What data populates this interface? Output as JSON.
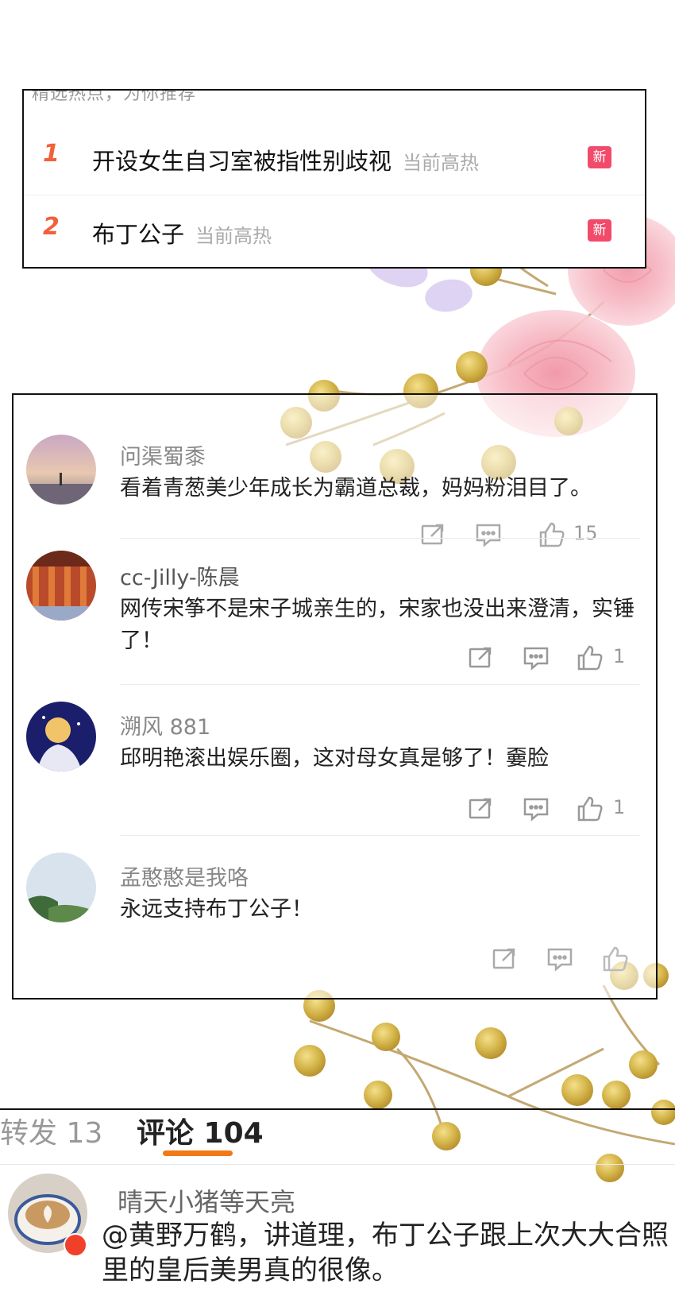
{
  "trending": {
    "subtitle": "精选热点，为你推荐",
    "items": [
      {
        "rank": "1",
        "title": "开设女生自习室被指性别歧视",
        "tag": "当前高热",
        "badge": "新"
      },
      {
        "rank": "2",
        "title": "布丁公子",
        "tag": "当前高热",
        "badge": "新"
      }
    ],
    "rank_color": "#f2603b",
    "badge_color": "#f24a6a"
  },
  "comments": [
    {
      "user": "问渠蜀黍",
      "text": "看着青葱美少年成长为霸道总裁，妈妈粉泪目了。",
      "likes": "15"
    },
    {
      "user": "cc-Jilly-陈晨",
      "text": "网传宋筝不是宋子城亲生的，宋家也没出来澄清，实锤了！",
      "likes": "1"
    },
    {
      "user": "溯风 881",
      "text": "邱明艳滚出娱乐圈，这对母女真是够了！嫑脸",
      "likes": "1"
    },
    {
      "user": "孟憨憨是我咯",
      "text": "永远支持布丁公子！",
      "likes": ""
    }
  ],
  "tabs": {
    "repost_label": "转发 13",
    "comment_label": "评论 104",
    "accent": "#f07a16"
  },
  "featured_comment": {
    "user": "晴天小猪等天亮",
    "text": "@黄野万鹤，讲道理，布丁公子跟上次大大合照里的皇后美男真的很像。"
  }
}
